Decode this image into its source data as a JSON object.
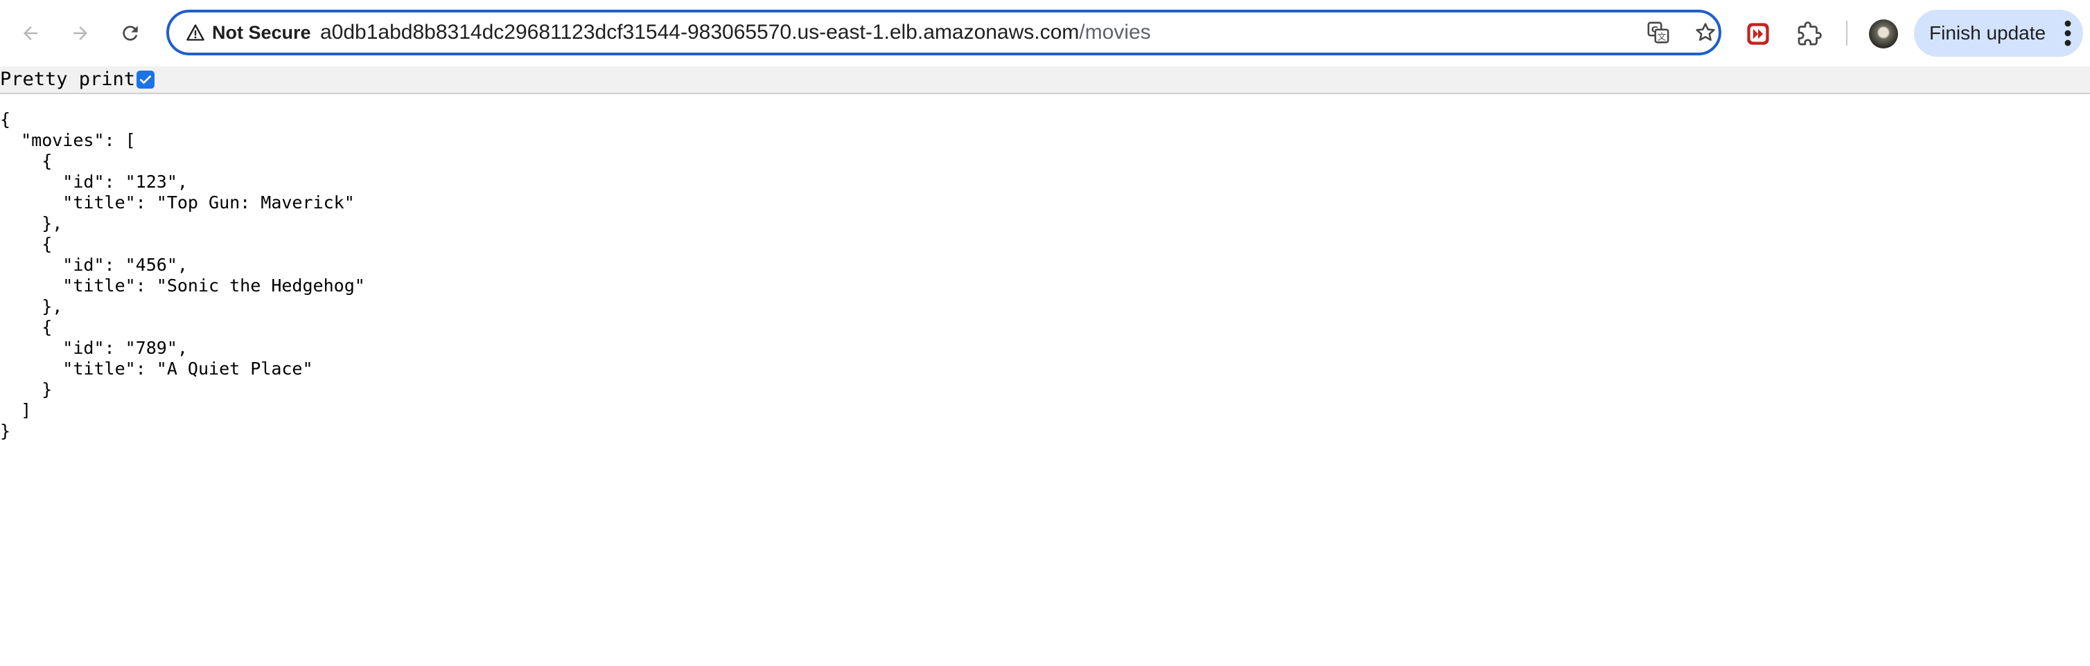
{
  "browser": {
    "nav": {
      "back_icon": "arrow-left-icon",
      "forward_icon": "arrow-right-icon",
      "reload_icon": "reload-icon"
    },
    "omnibox": {
      "security_label": "Not Secure",
      "security_icon": "warning-triangle-icon",
      "url_host": "a0db1abd8b8314dc29681123dcf31544-983065570.us-east-1.elb.amazonaws.com",
      "url_path": "/movies",
      "translate_icon": "translate-icon",
      "bookmark_icon": "star-icon"
    },
    "toolbar": {
      "extension_icon": "red-extension-icon",
      "puzzle_icon": "puzzle-icon",
      "profile_icon": "avatar",
      "update_label": "Finish update",
      "menu_icon": "kebab-menu-icon"
    },
    "colors": {
      "omnibox_border": "#1f5fc9",
      "update_bg": "#d3e3fd",
      "checkbox": "#1a73e8",
      "extension_red": "#c5221f"
    }
  },
  "viewer": {
    "pretty_print_label": "Pretty print",
    "pretty_print_checked": true
  },
  "json_text": "{\n  \"movies\": [\n    {\n      \"id\": \"123\",\n      \"title\": \"Top Gun: Maverick\"\n    },\n    {\n      \"id\": \"456\",\n      \"title\": \"Sonic the Hedgehog\"\n    },\n    {\n      \"id\": \"789\",\n      \"title\": \"A Quiet Place\"\n    }\n  ]\n}"
}
